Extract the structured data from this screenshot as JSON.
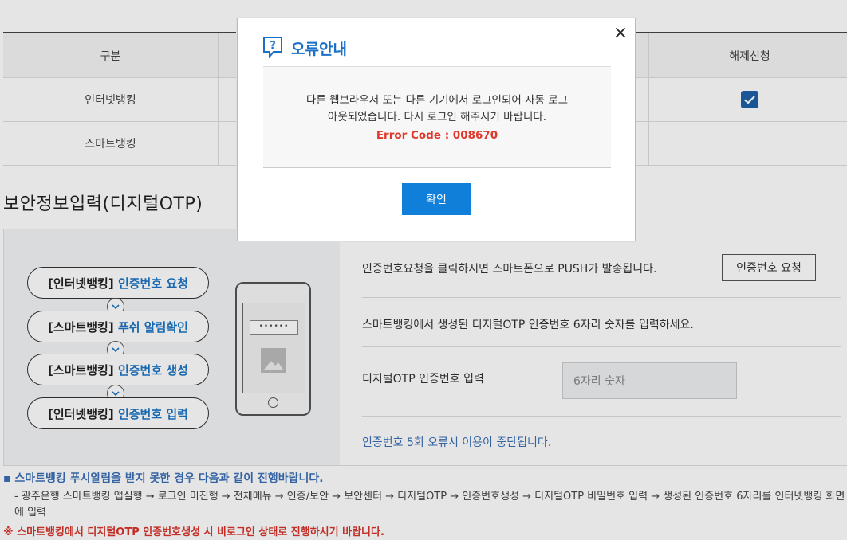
{
  "table": {
    "headers": [
      "구분",
      "",
      "해제신청"
    ],
    "rows": [
      {
        "label": "인터넷뱅킹",
        "checked": true
      },
      {
        "label": "스마트뱅킹",
        "checked": false
      }
    ]
  },
  "section_title": "보안정보입력(디지털OTP)",
  "steps": [
    {
      "prefix": "[인터넷뱅킹]",
      "action": "인증번호 요청"
    },
    {
      "prefix": "[스마트뱅킹]",
      "action": "푸쉬 알림확인"
    },
    {
      "prefix": "[스마트뱅킹]",
      "action": "인증번호 생성"
    },
    {
      "prefix": "[인터넷뱅킹]",
      "action": "인증번호 입력"
    }
  ],
  "phone_mask": "••••••",
  "otp": {
    "push_text": "인증번호요청을 클릭하시면 스마트폰으로 PUSH가 발송됩니다.",
    "request_button": "인증번호 요청",
    "generate_text": "스마트뱅킹에서 생성된 디지털OTP 인증번호 6자리 숫자를 입력하세요.",
    "input_label": "디지털OTP 인증번호 입력",
    "input_placeholder": "6자리 숫자",
    "warning": "인증번호 5회 오류시 이용이 중단됩니다."
  },
  "notes": {
    "n1": "스마트뱅킹 푸시알림을 받지 못한 경우 다음과 같이 진행바랍니다.",
    "n2": "- 광주은행 스마트뱅킹 앱실행 → 로그인 미진행 → 전체메뉴 → 인증/보안 → 보안센터 → 디지털OTP → 인증번호생성 → 디지털OTP 비밀번호 입력 → 생성된 인증번호 6자리를 인터넷뱅킹 화면에 입력",
    "n3": "※ 스마트뱅킹에서 디지털OTP 인증번호생성 시 비로그인 상태로 진행하시기 바랍니다."
  },
  "modal": {
    "title": "오류안내",
    "message_line1": "다른 웹브라우저 또는 다른 기기에서 로그인되어 자동 로그",
    "message_line2": "아웃되었습니다. 다시 로그인 해주시기 바랍니다.",
    "error_code": "Error Code : 008670",
    "ok_button": "확인",
    "close_glyph": "×"
  }
}
